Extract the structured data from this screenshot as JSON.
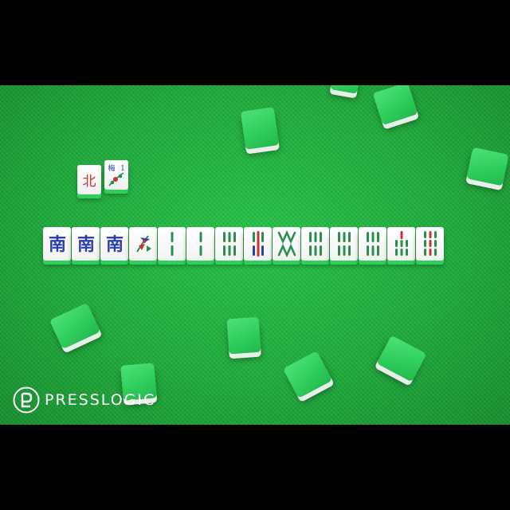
{
  "brand": {
    "logo_text": "PRESSLOGIC",
    "logo_icon": "presslogic-logo-icon"
  },
  "tiles": {
    "small_tile_1_char": "北",
    "small_tile_2_char": "梅",
    "small_tile_2_number": "1",
    "row_chars": [
      "南",
      "南",
      "南"
    ]
  },
  "colors": {
    "felt": "#1fae3c",
    "tile_back": "#2fcf5c",
    "tile_face": "#ffffff",
    "bamboo_green": "#2a8f4a",
    "bamboo_red": "#c8352e",
    "wind_blue": "#2a3fb0"
  }
}
